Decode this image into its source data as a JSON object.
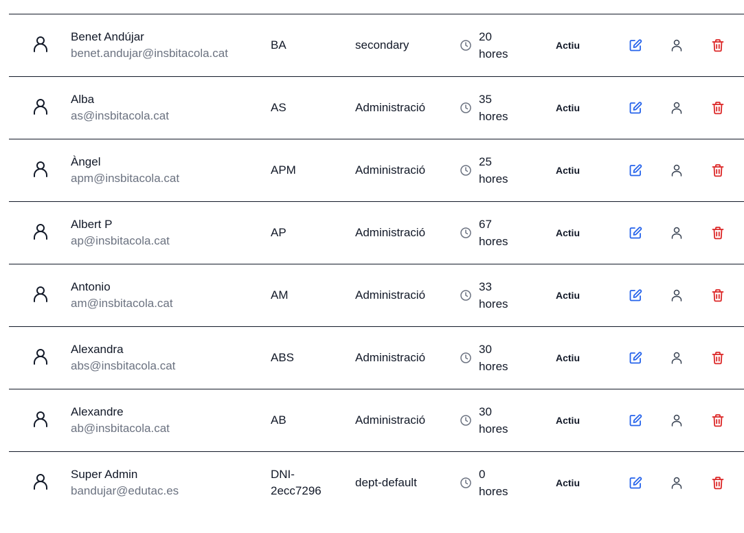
{
  "colors": {
    "edit": "#2563eb",
    "delete": "#dc2626",
    "muted": "#6b7280",
    "text": "#111827",
    "icon": "#374151"
  },
  "hours_unit": "hores",
  "users": [
    {
      "name": "Benet Andújar",
      "email": "benet.andujar@insbitacola.cat",
      "code": "BA",
      "department": "secondary",
      "hours": "20",
      "status": "Actiu"
    },
    {
      "name": "Alba",
      "email": "as@insbitacola.cat",
      "code": "AS",
      "department": "Administració",
      "hours": "35",
      "status": "Actiu"
    },
    {
      "name": "Àngel",
      "email": "apm@insbitacola.cat",
      "code": "APM",
      "department": "Administració",
      "hours": "25",
      "status": "Actiu"
    },
    {
      "name": "Albert P",
      "email": "ap@insbitacola.cat",
      "code": "AP",
      "department": "Administració",
      "hours": "67",
      "status": "Actiu"
    },
    {
      "name": "Antonio",
      "email": "am@insbitacola.cat",
      "code": "AM",
      "department": "Administració",
      "hours": "33",
      "status": "Actiu"
    },
    {
      "name": "Alexandra",
      "email": "abs@insbitacola.cat",
      "code": "ABS",
      "department": "Administració",
      "hours": "30",
      "status": "Actiu"
    },
    {
      "name": "Alexandre",
      "email": "ab@insbitacola.cat",
      "code": "AB",
      "department": "Administració",
      "hours": "30",
      "status": "Actiu"
    },
    {
      "name": "Super Admin",
      "email": "bandujar@edutac.es",
      "code": "DNI-\n2ecc7296",
      "department": "dept-default",
      "hours": "0",
      "status": "Actiu"
    }
  ]
}
